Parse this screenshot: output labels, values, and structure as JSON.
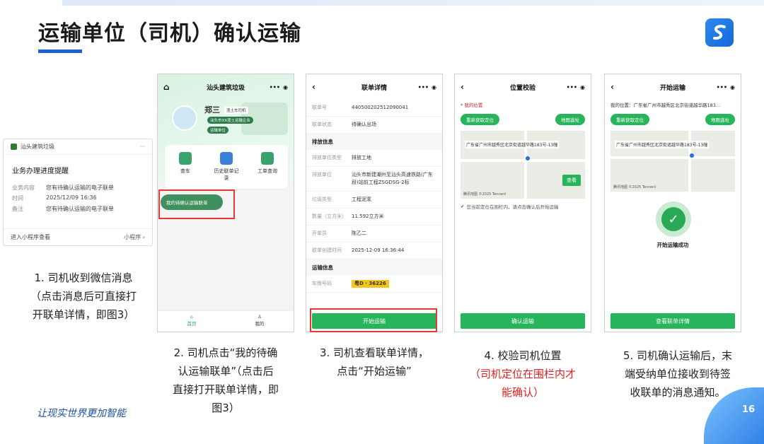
{
  "slide": {
    "title": "运输单位（司机）确认运输",
    "slogan": "让现实世界更加智能",
    "page_number": "16"
  },
  "wechat": {
    "app_name": "汕头建筑垃圾",
    "more": "···",
    "heading": "业务办理进度提醒",
    "rows": [
      {
        "k": "业务内容",
        "v": "您有待确认运输的电子联单"
      },
      {
        "k": "时间",
        "v": "2025/12/09 16:36"
      },
      {
        "k": "备注",
        "v": "您有待确认运输的电子联单"
      }
    ],
    "footer_left": "进入小程序查看",
    "footer_right": "小程序 ›"
  },
  "captions": {
    "c1": [
      "1. 司机收到微信消息",
      "（点击消息后可直接打",
      "开联单详情，即图3）"
    ],
    "c2": [
      "2. 司机点击“我的待确",
      "认运输联单”（点击后",
      "直接打开联单详情，即",
      "图3）"
    ],
    "c3": [
      "3. 司机查看联单详情，",
      "点击“开始运输”"
    ],
    "c4": [
      "4. 校验司机位置"
    ],
    "c4red": [
      "（司机定位在围栏内才",
      "能确认）"
    ],
    "c5": [
      "5. 司机确认运输后，末",
      "端受纳单位接收到待签",
      "收联单的消息通知。"
    ]
  },
  "phone1": {
    "title": "汕头建筑垃圾",
    "user_name": "郑三",
    "user_role": "渣土车司机",
    "company": "汕头市XX渣土运输企业",
    "unit_tag": "运输单位",
    "menu": [
      "查车",
      "历史联单记录",
      "工单查询"
    ],
    "pending_button": "我的待确认运输联单",
    "tabs": [
      "首页",
      "我的"
    ]
  },
  "phone2": {
    "title": "联单详情",
    "rows_top": [
      {
        "k": "联单号",
        "v": "440500202512090041"
      },
      {
        "k": "联单状态",
        "v": "待确认出场"
      }
    ],
    "sec1": "排放信息",
    "rows_mid": [
      {
        "k": "排放单位类型",
        "v": "排放工地"
      },
      {
        "k": "排放单位",
        "v": "汕头市新建潮州至汕头高速铁路(广东段)站前工程ZSGDSG-2标"
      },
      {
        "k": "垃圾类型",
        "v": "工程泥浆"
      },
      {
        "k": "数量（立方米）",
        "v": "11.592立方米"
      },
      {
        "k": "开单员",
        "v": "陈乙二"
      },
      {
        "k": "联单创建时间",
        "v": "2025-12-09 16:36:44"
      }
    ],
    "sec2": "运输信息",
    "plate_label": "车牌号码",
    "plate": "粤D · 36226",
    "button": "开始运输"
  },
  "phone3": {
    "title": "位置校验",
    "my_loc": "* 我的位置",
    "relocate": "重新获取定位",
    "map_addr": "地图选址",
    "map_label": "广东省广州市越秀区北京街道越华路183号-13幢",
    "view": "查看",
    "tip": "您当前定位在围栏内，请点击确认后开始运输",
    "button": "确认运输"
  },
  "phone4": {
    "title": "开始运输",
    "loc": "我的位置：广东省广州市越秀区北京街道越华路183...",
    "relocate": "重新获取定位",
    "map_addr": "地图选址",
    "map_label": "广东省广州市越秀区北京街道越华路183号-13幢",
    "success": "开始运输成功",
    "button": "查看联单详情"
  },
  "map_watermark": "腾讯地图 ©2025 Tencent"
}
